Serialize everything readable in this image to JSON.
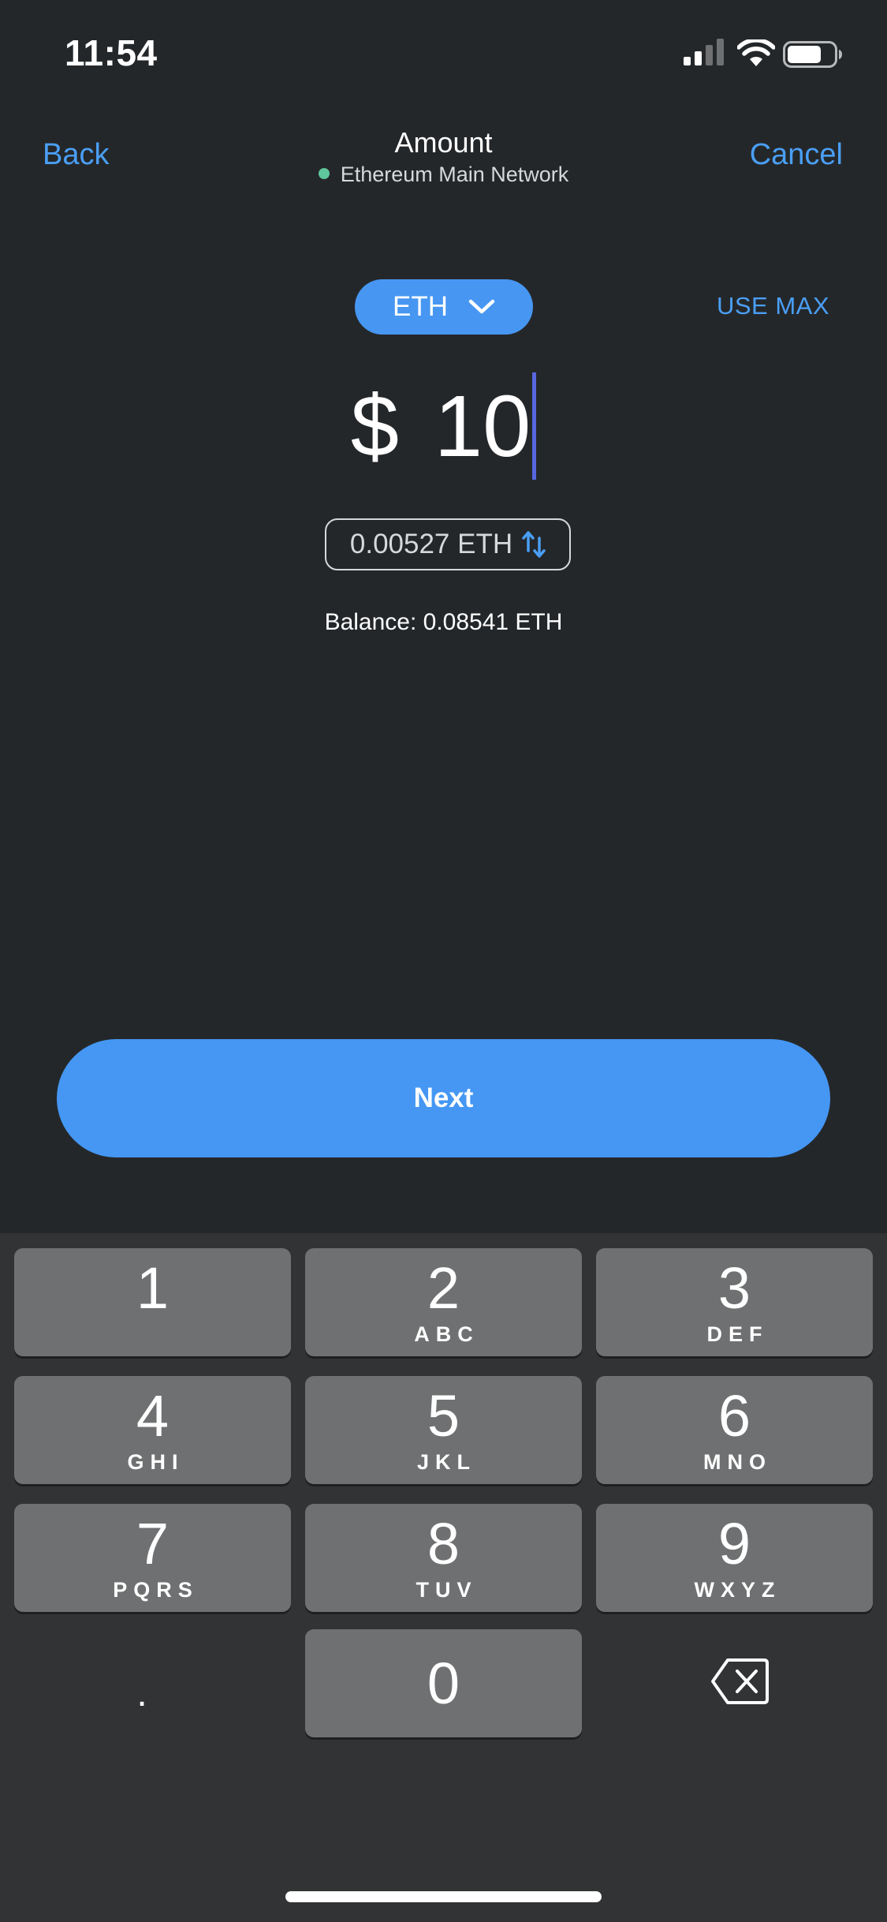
{
  "status_bar": {
    "time": "11:54",
    "signal_icon": "signal-bars-icon",
    "wifi_icon": "wifi-icon",
    "battery_icon": "battery-icon"
  },
  "header": {
    "back_label": "Back",
    "title": "Amount",
    "network_name": "Ethereum Main Network",
    "network_status_color": "#5fc59c",
    "cancel_label": "Cancel"
  },
  "asset_selector": {
    "symbol": "ETH",
    "dropdown_icon": "chevron-down-icon",
    "use_max_label": "USE MAX"
  },
  "amount": {
    "currency_symbol": "$",
    "value": "10"
  },
  "conversion": {
    "text": "0.00527 ETH",
    "swap_icon": "swap-arrows-icon"
  },
  "balance": {
    "text": "Balance: 0.08541 ETH"
  },
  "next_button": {
    "label": "Next"
  },
  "keypad": {
    "keys": [
      {
        "digit": "1",
        "letters": ""
      },
      {
        "digit": "2",
        "letters": "ABC"
      },
      {
        "digit": "3",
        "letters": "DEF"
      },
      {
        "digit": "4",
        "letters": "GHI"
      },
      {
        "digit": "5",
        "letters": "JKL"
      },
      {
        "digit": "6",
        "letters": "MNO"
      },
      {
        "digit": "7",
        "letters": "PQRS"
      },
      {
        "digit": "8",
        "letters": "TUV"
      },
      {
        "digit": "9",
        "letters": "WXYZ"
      },
      {
        "digit": "0",
        "letters": ""
      }
    ],
    "decimal_key": ".",
    "delete_icon": "backspace-icon"
  },
  "colors": {
    "background": "#24272a",
    "accent": "#4597f3",
    "keypad_background": "#313335",
    "key_background": "#6f7071",
    "caret": "#5767e0"
  }
}
